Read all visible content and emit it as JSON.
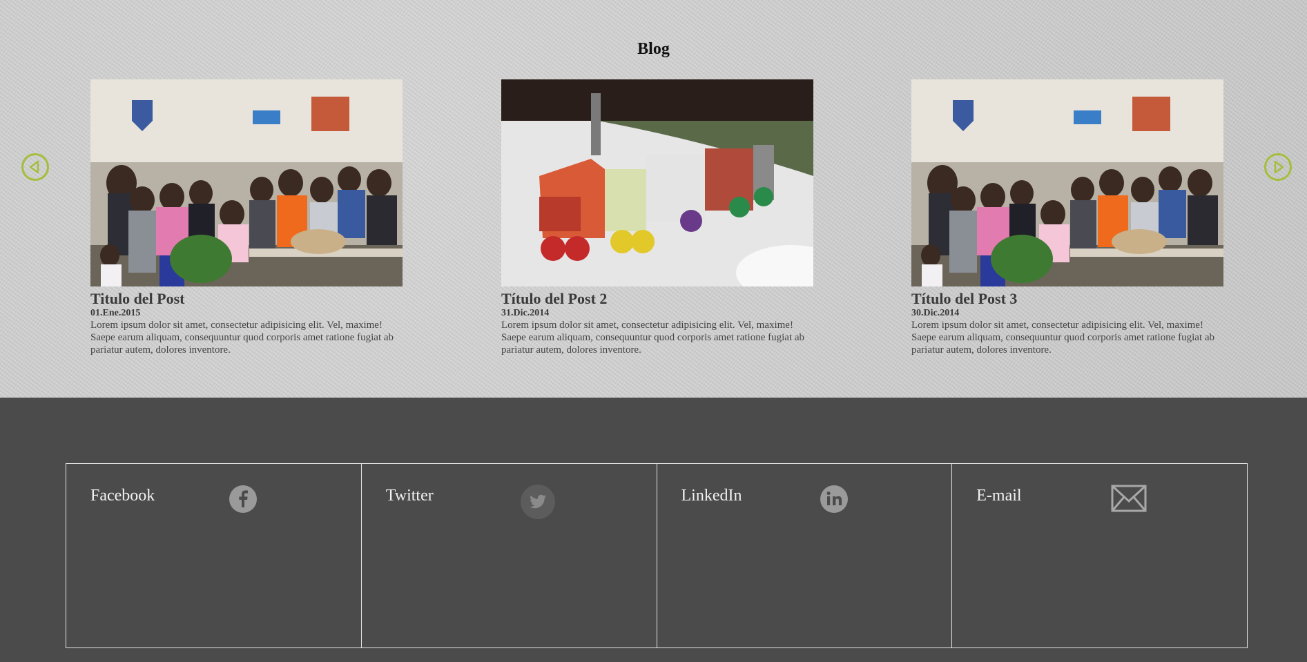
{
  "blog": {
    "heading": "Blog",
    "prev_icon": "arrow-left-circle-icon",
    "next_icon": "arrow-right-circle-icon",
    "accent": "#a4be3c",
    "posts": [
      {
        "title": "Titulo del Post",
        "date": "01.Ene.2015",
        "excerpt": "Lorem ipsum dolor sit amet, consectetur adipisicing elit. Vel, maxime! Saepe earum aliquam, consequuntur quod corporis amet ratione fugiat ab pariatur autem, dolores inventore."
      },
      {
        "title": "Título del Post 2",
        "date": "31.Dic.2014",
        "excerpt": "Lorem ipsum dolor sit amet, consectetur adipisicing elit. Vel, maxime! Saepe earum aliquam, consequuntur quod corporis amet ratione fugiat ab pariatur autem, dolores inventore."
      },
      {
        "title": "Título del Post 3",
        "date": "30.Dic.2014",
        "excerpt": "Lorem ipsum dolor sit amet, consectetur adipisicing elit. Vel, maxime! Saepe earum aliquam, consequuntur quod corporis amet ratione fugiat ab pariatur autem, dolores inventore."
      }
    ]
  },
  "social": {
    "items": [
      {
        "label": "Facebook",
        "icon": "facebook-icon"
      },
      {
        "label": "Twitter",
        "icon": "twitter-icon"
      },
      {
        "label": "LinkedIn",
        "icon": "linkedin-icon"
      },
      {
        "label": "E-mail",
        "icon": "email-icon"
      }
    ]
  },
  "colors": {
    "footer_bg": "#4b4b4b",
    "blog_bg": "#cdcdcd",
    "icon_gray": "#9a9a9a"
  }
}
